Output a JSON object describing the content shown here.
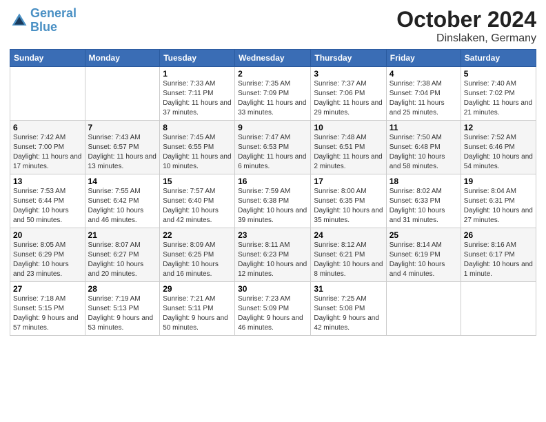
{
  "header": {
    "logo_line1": "General",
    "logo_line2": "Blue",
    "month": "October 2024",
    "location": "Dinslaken, Germany"
  },
  "weekdays": [
    "Sunday",
    "Monday",
    "Tuesday",
    "Wednesday",
    "Thursday",
    "Friday",
    "Saturday"
  ],
  "weeks": [
    [
      {
        "day": "",
        "sunrise": "",
        "sunset": "",
        "daylight": ""
      },
      {
        "day": "",
        "sunrise": "",
        "sunset": "",
        "daylight": ""
      },
      {
        "day": "1",
        "sunrise": "Sunrise: 7:33 AM",
        "sunset": "Sunset: 7:11 PM",
        "daylight": "Daylight: 11 hours and 37 minutes."
      },
      {
        "day": "2",
        "sunrise": "Sunrise: 7:35 AM",
        "sunset": "Sunset: 7:09 PM",
        "daylight": "Daylight: 11 hours and 33 minutes."
      },
      {
        "day": "3",
        "sunrise": "Sunrise: 7:37 AM",
        "sunset": "Sunset: 7:06 PM",
        "daylight": "Daylight: 11 hours and 29 minutes."
      },
      {
        "day": "4",
        "sunrise": "Sunrise: 7:38 AM",
        "sunset": "Sunset: 7:04 PM",
        "daylight": "Daylight: 11 hours and 25 minutes."
      },
      {
        "day": "5",
        "sunrise": "Sunrise: 7:40 AM",
        "sunset": "Sunset: 7:02 PM",
        "daylight": "Daylight: 11 hours and 21 minutes."
      }
    ],
    [
      {
        "day": "6",
        "sunrise": "Sunrise: 7:42 AM",
        "sunset": "Sunset: 7:00 PM",
        "daylight": "Daylight: 11 hours and 17 minutes."
      },
      {
        "day": "7",
        "sunrise": "Sunrise: 7:43 AM",
        "sunset": "Sunset: 6:57 PM",
        "daylight": "Daylight: 11 hours and 13 minutes."
      },
      {
        "day": "8",
        "sunrise": "Sunrise: 7:45 AM",
        "sunset": "Sunset: 6:55 PM",
        "daylight": "Daylight: 11 hours and 10 minutes."
      },
      {
        "day": "9",
        "sunrise": "Sunrise: 7:47 AM",
        "sunset": "Sunset: 6:53 PM",
        "daylight": "Daylight: 11 hours and 6 minutes."
      },
      {
        "day": "10",
        "sunrise": "Sunrise: 7:48 AM",
        "sunset": "Sunset: 6:51 PM",
        "daylight": "Daylight: 11 hours and 2 minutes."
      },
      {
        "day": "11",
        "sunrise": "Sunrise: 7:50 AM",
        "sunset": "Sunset: 6:48 PM",
        "daylight": "Daylight: 10 hours and 58 minutes."
      },
      {
        "day": "12",
        "sunrise": "Sunrise: 7:52 AM",
        "sunset": "Sunset: 6:46 PM",
        "daylight": "Daylight: 10 hours and 54 minutes."
      }
    ],
    [
      {
        "day": "13",
        "sunrise": "Sunrise: 7:53 AM",
        "sunset": "Sunset: 6:44 PM",
        "daylight": "Daylight: 10 hours and 50 minutes."
      },
      {
        "day": "14",
        "sunrise": "Sunrise: 7:55 AM",
        "sunset": "Sunset: 6:42 PM",
        "daylight": "Daylight: 10 hours and 46 minutes."
      },
      {
        "day": "15",
        "sunrise": "Sunrise: 7:57 AM",
        "sunset": "Sunset: 6:40 PM",
        "daylight": "Daylight: 10 hours and 42 minutes."
      },
      {
        "day": "16",
        "sunrise": "Sunrise: 7:59 AM",
        "sunset": "Sunset: 6:38 PM",
        "daylight": "Daylight: 10 hours and 39 minutes."
      },
      {
        "day": "17",
        "sunrise": "Sunrise: 8:00 AM",
        "sunset": "Sunset: 6:35 PM",
        "daylight": "Daylight: 10 hours and 35 minutes."
      },
      {
        "day": "18",
        "sunrise": "Sunrise: 8:02 AM",
        "sunset": "Sunset: 6:33 PM",
        "daylight": "Daylight: 10 hours and 31 minutes."
      },
      {
        "day": "19",
        "sunrise": "Sunrise: 8:04 AM",
        "sunset": "Sunset: 6:31 PM",
        "daylight": "Daylight: 10 hours and 27 minutes."
      }
    ],
    [
      {
        "day": "20",
        "sunrise": "Sunrise: 8:05 AM",
        "sunset": "Sunset: 6:29 PM",
        "daylight": "Daylight: 10 hours and 23 minutes."
      },
      {
        "day": "21",
        "sunrise": "Sunrise: 8:07 AM",
        "sunset": "Sunset: 6:27 PM",
        "daylight": "Daylight: 10 hours and 20 minutes."
      },
      {
        "day": "22",
        "sunrise": "Sunrise: 8:09 AM",
        "sunset": "Sunset: 6:25 PM",
        "daylight": "Daylight: 10 hours and 16 minutes."
      },
      {
        "day": "23",
        "sunrise": "Sunrise: 8:11 AM",
        "sunset": "Sunset: 6:23 PM",
        "daylight": "Daylight: 10 hours and 12 minutes."
      },
      {
        "day": "24",
        "sunrise": "Sunrise: 8:12 AM",
        "sunset": "Sunset: 6:21 PM",
        "daylight": "Daylight: 10 hours and 8 minutes."
      },
      {
        "day": "25",
        "sunrise": "Sunrise: 8:14 AM",
        "sunset": "Sunset: 6:19 PM",
        "daylight": "Daylight: 10 hours and 4 minutes."
      },
      {
        "day": "26",
        "sunrise": "Sunrise: 8:16 AM",
        "sunset": "Sunset: 6:17 PM",
        "daylight": "Daylight: 10 hours and 1 minute."
      }
    ],
    [
      {
        "day": "27",
        "sunrise": "Sunrise: 7:18 AM",
        "sunset": "Sunset: 5:15 PM",
        "daylight": "Daylight: 9 hours and 57 minutes."
      },
      {
        "day": "28",
        "sunrise": "Sunrise: 7:19 AM",
        "sunset": "Sunset: 5:13 PM",
        "daylight": "Daylight: 9 hours and 53 minutes."
      },
      {
        "day": "29",
        "sunrise": "Sunrise: 7:21 AM",
        "sunset": "Sunset: 5:11 PM",
        "daylight": "Daylight: 9 hours and 50 minutes."
      },
      {
        "day": "30",
        "sunrise": "Sunrise: 7:23 AM",
        "sunset": "Sunset: 5:09 PM",
        "daylight": "Daylight: 9 hours and 46 minutes."
      },
      {
        "day": "31",
        "sunrise": "Sunrise: 7:25 AM",
        "sunset": "Sunset: 5:08 PM",
        "daylight": "Daylight: 9 hours and 42 minutes."
      },
      {
        "day": "",
        "sunrise": "",
        "sunset": "",
        "daylight": ""
      },
      {
        "day": "",
        "sunrise": "",
        "sunset": "",
        "daylight": ""
      }
    ]
  ]
}
